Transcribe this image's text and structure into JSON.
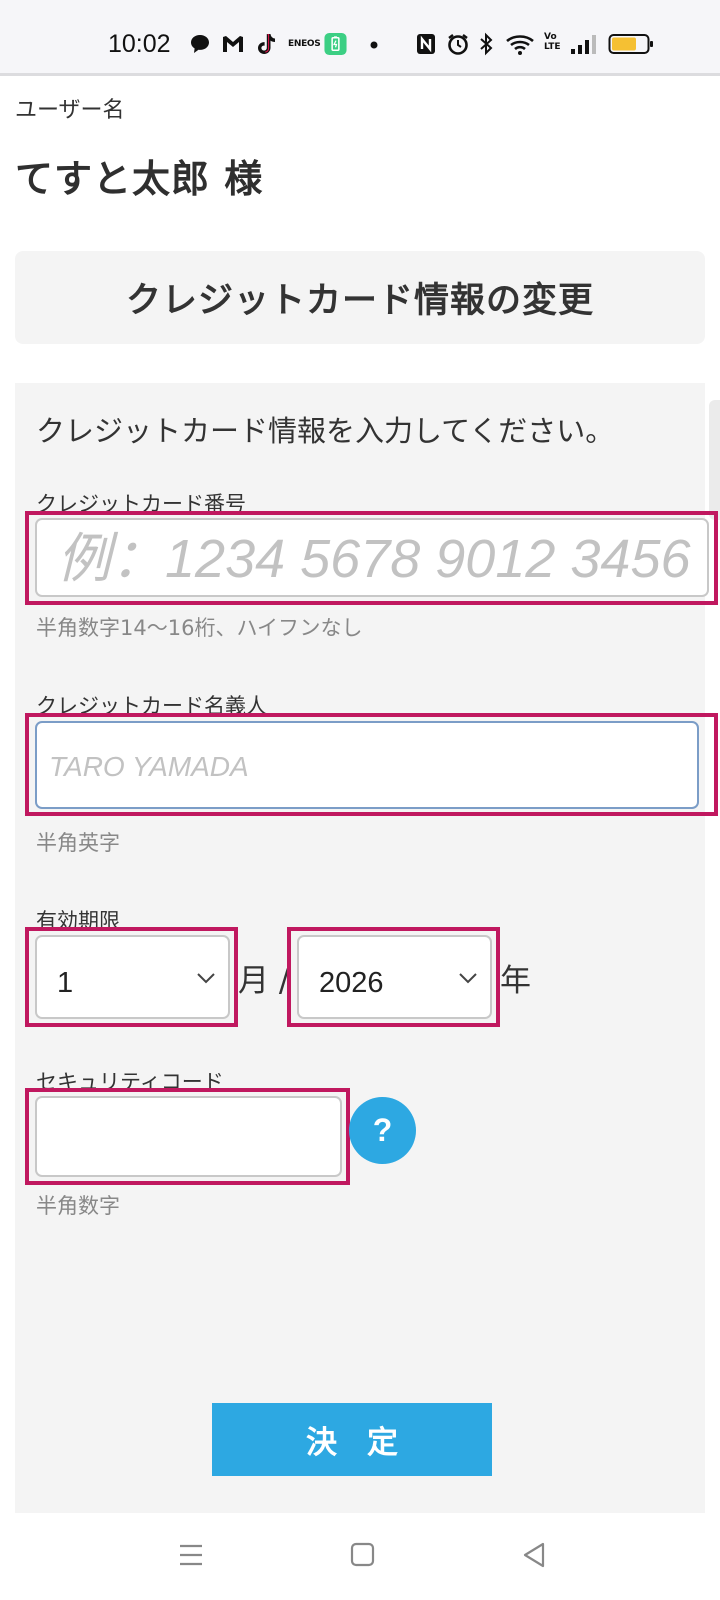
{
  "status_bar": {
    "time": "10:02",
    "icons": [
      "chat-bubble-icon",
      "gmail-icon",
      "tiktok-icon",
      "eneos-icon",
      "battery-saver-icon",
      "dot-icon",
      "nfc-icon",
      "alarm-icon",
      "bluetooth-icon",
      "wifi-icon",
      "volte-icon",
      "signal-icon",
      "battery-icon"
    ],
    "eneos_text": "ENEOS",
    "volte_text": "Vo LTE"
  },
  "user": {
    "label": "ユーザー名",
    "name": "てすと太郎 様"
  },
  "page_title": "クレジットカード情報の変更",
  "form": {
    "intro": "クレジットカード情報を入力してください。",
    "card_number": {
      "label": "クレジットカード番号",
      "placeholder": "例：1234 5678 9012 3456",
      "hint": "半角数字14〜16桁、ハイフンなし"
    },
    "card_holder": {
      "label": "クレジットカード名義人",
      "placeholder": "TARO YAMADA",
      "hint": "半角英字"
    },
    "expiry": {
      "label": "有効期限",
      "month_value": "1",
      "month_unit": "月 /",
      "year_value": "2026",
      "year_unit": "年"
    },
    "security_code": {
      "label": "セキュリティコード",
      "value": "",
      "help_label": "?",
      "hint": "半角数字"
    },
    "submit_label": "決定"
  },
  "colors": {
    "accent": "#2da8e2",
    "highlight": "#c0185f",
    "panel": "#f4f4f4"
  }
}
